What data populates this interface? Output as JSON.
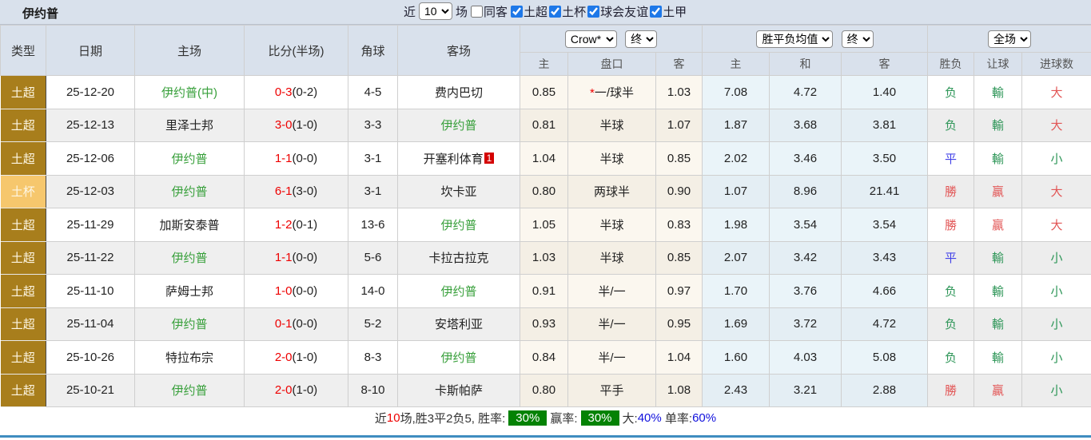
{
  "page_title": "伊约普",
  "topbar": {
    "recent_label": "近",
    "recent_value": "10",
    "suffix_label": "场",
    "same_away": {
      "label": "同客",
      "checked": false
    },
    "filters": [
      {
        "label": "土超",
        "checked": true
      },
      {
        "label": "土杯",
        "checked": true
      },
      {
        "label": "球会友谊",
        "checked": true
      },
      {
        "label": "土甲",
        "checked": true
      }
    ]
  },
  "table": {
    "col_headers": {
      "type": "类型",
      "date": "日期",
      "home": "主场",
      "score": "比分(半场)",
      "corner": "角球",
      "away": "客场",
      "ah_home": "主",
      "ah_line": "盘口",
      "ah_away": "客",
      "eu_home": "主",
      "eu_draw": "和",
      "eu_away": "客",
      "result": "胜负",
      "ah_result": "让球",
      "ou_result": "进球数"
    },
    "selects": {
      "bookmaker": "Crow*",
      "ah_stage": "终",
      "euro_metric": "胜平负均值",
      "euro_stage": "终",
      "scope": "全场"
    },
    "rows": [
      {
        "type": "土超",
        "type_variant": "league",
        "date": "25-12-20",
        "home": "伊约普(中)",
        "home_color": "green",
        "score_ft": "0-3",
        "score_ht": "(0-2)",
        "corner": "4-5",
        "away": "费内巴切",
        "away_color": "black",
        "away_badge": "",
        "ah_home": "0.85",
        "line_prefix": "*",
        "line": "一/球半",
        "ah_away": "1.03",
        "eu_home": "7.08",
        "eu_draw": "4.72",
        "eu_away": "1.40",
        "result": "负",
        "result_color": "green",
        "ah_result": "輸",
        "ah_result_color": "green",
        "ou_result": "大",
        "ou_result_color": "red"
      },
      {
        "type": "土超",
        "type_variant": "league",
        "date": "25-12-13",
        "home": "里泽士邦",
        "home_color": "black",
        "score_ft": "3-0",
        "score_ht": "(1-0)",
        "corner": "3-3",
        "away": "伊约普",
        "away_color": "green",
        "away_badge": "",
        "ah_home": "0.81",
        "line_prefix": "",
        "line": "半球",
        "ah_away": "1.07",
        "eu_home": "1.87",
        "eu_draw": "3.68",
        "eu_away": "3.81",
        "result": "负",
        "result_color": "green",
        "ah_result": "輸",
        "ah_result_color": "green",
        "ou_result": "大",
        "ou_result_color": "red"
      },
      {
        "type": "土超",
        "type_variant": "league",
        "date": "25-12-06",
        "home": "伊约普",
        "home_color": "green",
        "score_ft": "1-1",
        "score_ht": "(0-0)",
        "corner": "3-1",
        "away": "开塞利体育",
        "away_color": "black",
        "away_badge": "1",
        "ah_home": "1.04",
        "line_prefix": "",
        "line": "半球",
        "ah_away": "0.85",
        "eu_home": "2.02",
        "eu_draw": "3.46",
        "eu_away": "3.50",
        "result": "平",
        "result_color": "blue",
        "ah_result": "輸",
        "ah_result_color": "green",
        "ou_result": "小",
        "ou_result_color": "green"
      },
      {
        "type": "土杯",
        "type_variant": "cup",
        "date": "25-12-03",
        "home": "伊约普",
        "home_color": "green",
        "score_ft": "6-1",
        "score_ht": "(3-0)",
        "corner": "3-1",
        "away": "坎卡亚",
        "away_color": "black",
        "away_badge": "",
        "ah_home": "0.80",
        "line_prefix": "",
        "line": "两球半",
        "ah_away": "0.90",
        "eu_home": "1.07",
        "eu_draw": "8.96",
        "eu_away": "21.41",
        "result": "勝",
        "result_color": "red",
        "ah_result": "贏",
        "ah_result_color": "red",
        "ou_result": "大",
        "ou_result_color": "red"
      },
      {
        "type": "土超",
        "type_variant": "league",
        "date": "25-11-29",
        "home": "加斯安泰普",
        "home_color": "black",
        "score_ft": "1-2",
        "score_ht": "(0-1)",
        "corner": "13-6",
        "away": "伊约普",
        "away_color": "green",
        "away_badge": "",
        "ah_home": "1.05",
        "line_prefix": "",
        "line": "半球",
        "ah_away": "0.83",
        "eu_home": "1.98",
        "eu_draw": "3.54",
        "eu_away": "3.54",
        "result": "勝",
        "result_color": "red",
        "ah_result": "贏",
        "ah_result_color": "red",
        "ou_result": "大",
        "ou_result_color": "red"
      },
      {
        "type": "土超",
        "type_variant": "league",
        "date": "25-11-22",
        "home": "伊约普",
        "home_color": "green",
        "score_ft": "1-1",
        "score_ht": "(0-0)",
        "corner": "5-6",
        "away": "卡拉古拉克",
        "away_color": "black",
        "away_badge": "",
        "ah_home": "1.03",
        "line_prefix": "",
        "line": "半球",
        "ah_away": "0.85",
        "eu_home": "2.07",
        "eu_draw": "3.42",
        "eu_away": "3.43",
        "result": "平",
        "result_color": "blue",
        "ah_result": "輸",
        "ah_result_color": "green",
        "ou_result": "小",
        "ou_result_color": "green"
      },
      {
        "type": "土超",
        "type_variant": "league",
        "date": "25-11-10",
        "home": "萨姆士邦",
        "home_color": "black",
        "score_ft": "1-0",
        "score_ht": "(0-0)",
        "corner": "14-0",
        "away": "伊约普",
        "away_color": "green",
        "away_badge": "",
        "ah_home": "0.91",
        "line_prefix": "",
        "line": "半/一",
        "ah_away": "0.97",
        "eu_home": "1.70",
        "eu_draw": "3.76",
        "eu_away": "4.66",
        "result": "负",
        "result_color": "green",
        "ah_result": "輸",
        "ah_result_color": "green",
        "ou_result": "小",
        "ou_result_color": "green"
      },
      {
        "type": "土超",
        "type_variant": "league",
        "date": "25-11-04",
        "home": "伊约普",
        "home_color": "green",
        "score_ft": "0-1",
        "score_ht": "(0-0)",
        "corner": "5-2",
        "away": "安塔利亚",
        "away_color": "black",
        "away_badge": "",
        "ah_home": "0.93",
        "line_prefix": "",
        "line": "半/一",
        "ah_away": "0.95",
        "eu_home": "1.69",
        "eu_draw": "3.72",
        "eu_away": "4.72",
        "result": "负",
        "result_color": "green",
        "ah_result": "輸",
        "ah_result_color": "green",
        "ou_result": "小",
        "ou_result_color": "green"
      },
      {
        "type": "土超",
        "type_variant": "league",
        "date": "25-10-26",
        "home": "特拉布宗",
        "home_color": "black",
        "score_ft": "2-0",
        "score_ht": "(1-0)",
        "corner": "8-3",
        "away": "伊约普",
        "away_color": "green",
        "away_badge": "",
        "ah_home": "0.84",
        "line_prefix": "",
        "line": "半/一",
        "ah_away": "1.04",
        "eu_home": "1.60",
        "eu_draw": "4.03",
        "eu_away": "5.08",
        "result": "负",
        "result_color": "green",
        "ah_result": "輸",
        "ah_result_color": "green",
        "ou_result": "小",
        "ou_result_color": "green"
      },
      {
        "type": "土超",
        "type_variant": "league",
        "date": "25-10-21",
        "home": "伊约普",
        "home_color": "green",
        "score_ft": "2-0",
        "score_ht": "(1-0)",
        "corner": "8-10",
        "away": "卡斯帕萨",
        "away_color": "black",
        "away_badge": "",
        "ah_home": "0.80",
        "line_prefix": "",
        "line": "平手",
        "ah_away": "1.08",
        "eu_home": "2.43",
        "eu_draw": "3.21",
        "eu_away": "2.88",
        "result": "勝",
        "result_color": "red",
        "ah_result": "贏",
        "ah_result_color": "red",
        "ou_result": "小",
        "ou_result_color": "green"
      }
    ]
  },
  "footer": {
    "segments": [
      {
        "text": "近",
        "style": "dark"
      },
      {
        "text": "10",
        "style": "red"
      },
      {
        "text": "场,胜3平2负5, 胜率:",
        "style": "dark"
      },
      {
        "text": "30%",
        "style": "badge"
      },
      {
        "text": "赢率:",
        "style": "dark"
      },
      {
        "text": "30%",
        "style": "badge"
      },
      {
        "text": "大:",
        "style": "dark"
      },
      {
        "text": "40%",
        "style": "blue"
      },
      {
        "text": " 单率:",
        "style": "dark"
      },
      {
        "text": "60%",
        "style": "blue"
      }
    ]
  },
  "colors": {
    "topbar_bg": "#D9E1EC",
    "type_league_bg": "#A87E1C",
    "type_cup_bg": "#F6C76D",
    "team_green": "#39A03C",
    "score_red": "#EE0000",
    "result_green": "#2E9658",
    "result_blue": "#4343E8",
    "result_red": "#E25555",
    "asian_odds_bg": "#FBF7EF",
    "euro_odds_bg": "#EAF4F9",
    "rate_badge_bg": "#048204",
    "footer_blue": "#1111DD",
    "bottom_line": "#3F8DC0",
    "away_badge_bg": "#D40000"
  }
}
